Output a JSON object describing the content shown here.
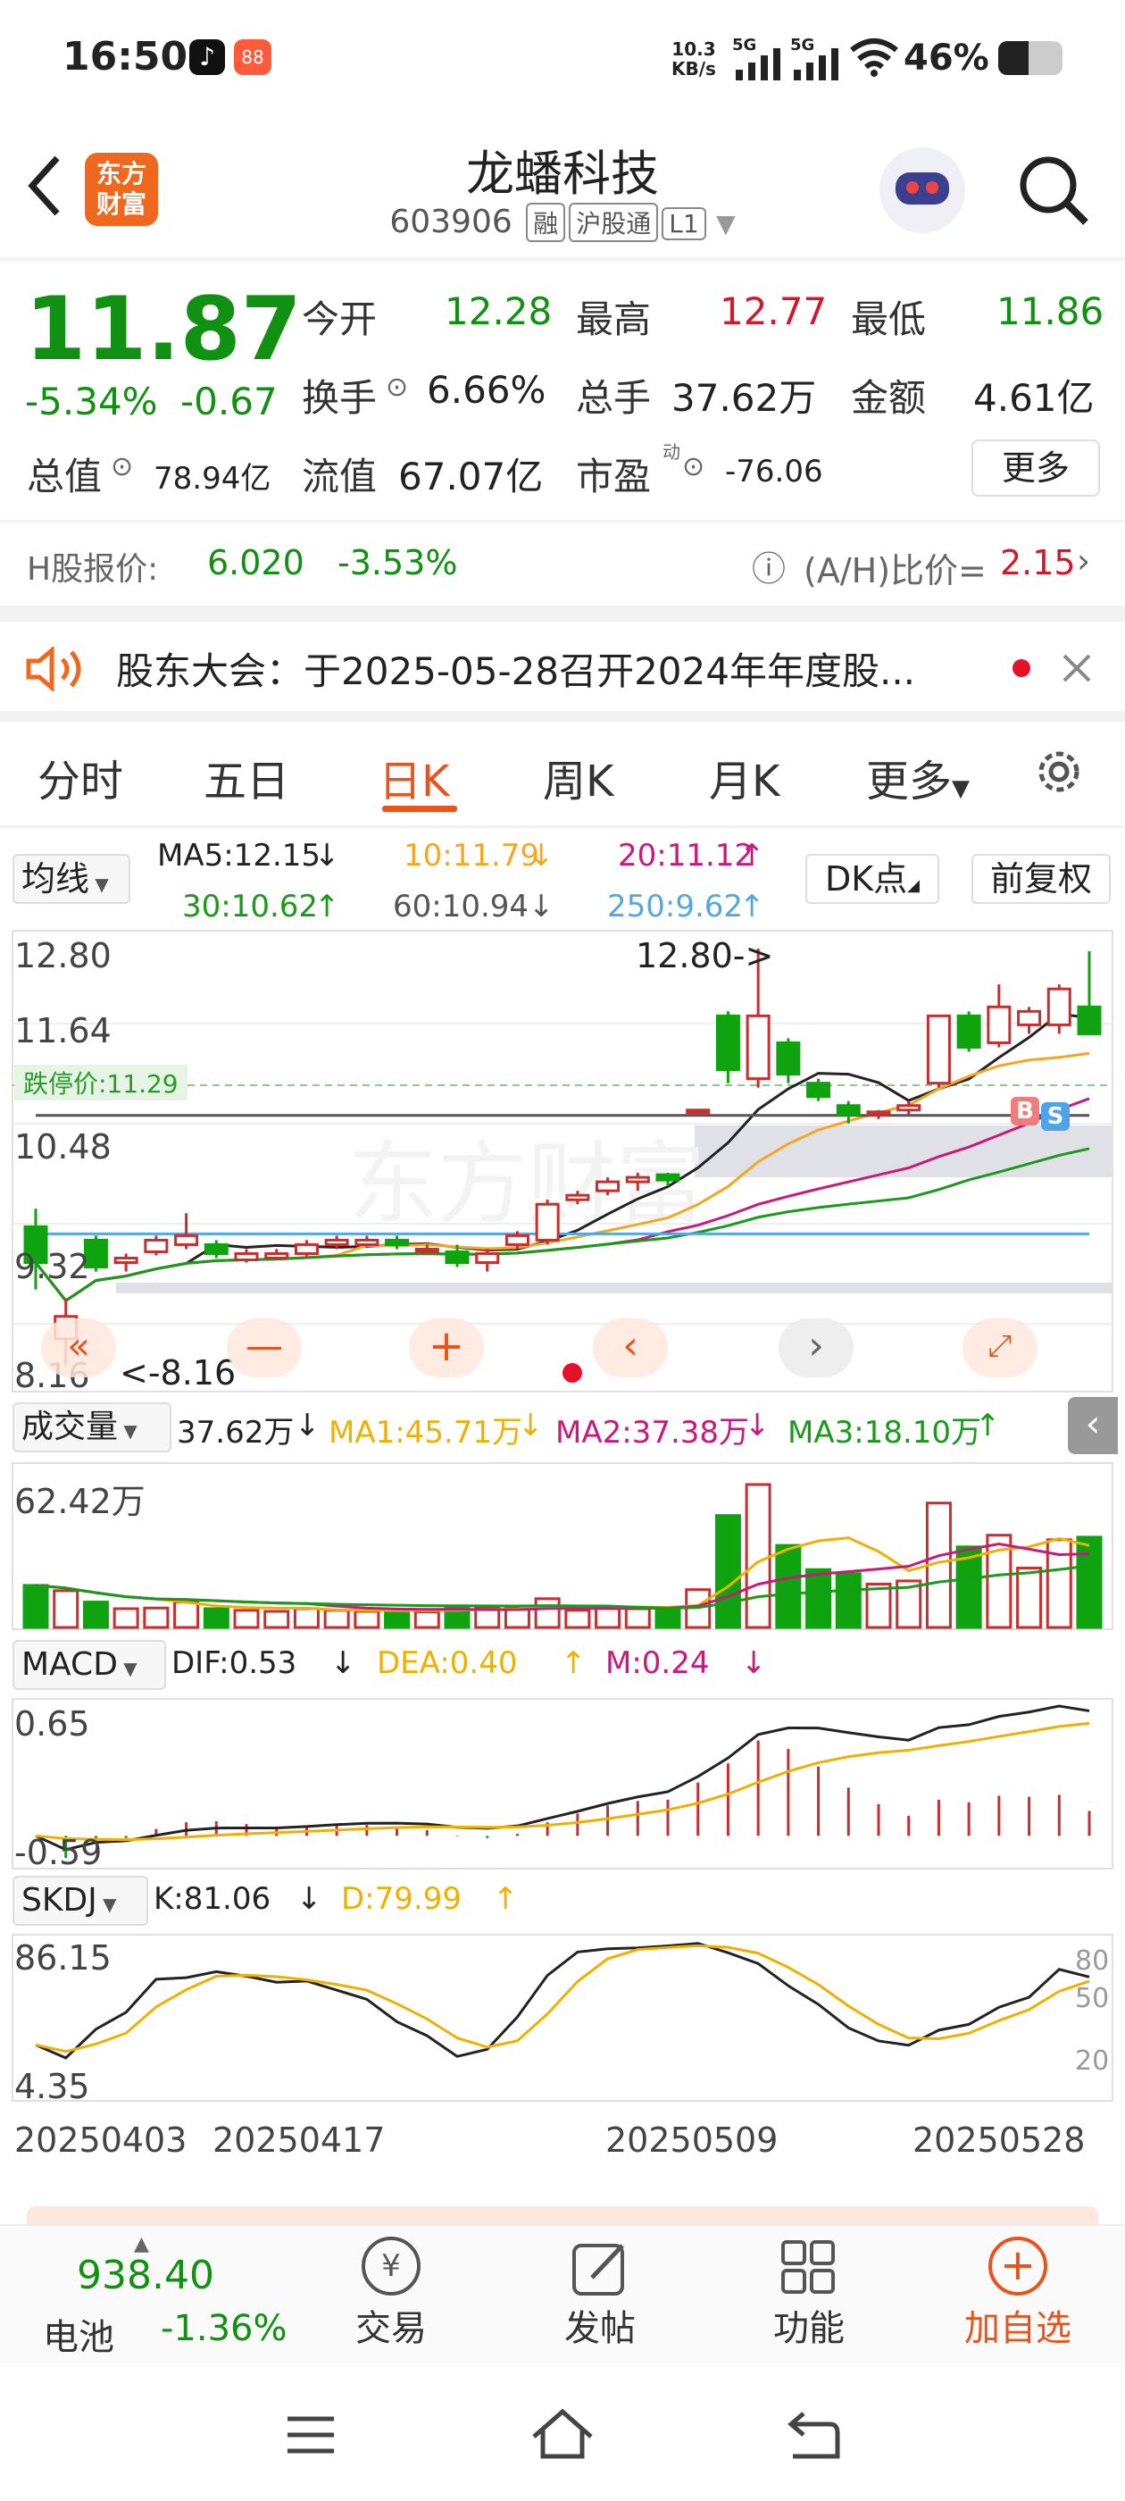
{
  "status": {
    "time": "16:50",
    "net_speed_top": "10.3",
    "net_speed_bot": "KB/s",
    "sig1": "5G",
    "sig2": "5G",
    "battery": "46%"
  },
  "header": {
    "name": "龙蟠科技",
    "code": "603906",
    "tags": [
      "融",
      "沪股通",
      "L1"
    ],
    "logo_top": "东方",
    "logo_bot": "财富"
  },
  "quote": {
    "price": "11.87",
    "pct": "-5.34%",
    "chg": "-0.67",
    "open_label": "今开",
    "open": "12.28",
    "high_label": "最高",
    "high": "12.77",
    "low_label": "最低",
    "low": "11.86",
    "turnover_label": "换手",
    "turnover": "6.66%",
    "volume_label": "总手",
    "volume": "37.62万",
    "amount_label": "金额",
    "amount": "4.61亿",
    "mktcap_label": "总值",
    "mktcap": "78.94亿",
    "float_label": "流值",
    "float": "67.07亿",
    "pe_label": "市盈",
    "pe_sup": "动",
    "pe": "-76.06",
    "more": "更多",
    "h_label": "H股报价:",
    "h_price": "6.020",
    "h_pct": "-3.53%",
    "ah_label": "(A/H)比价=",
    "ah_value": "2.15"
  },
  "notice": {
    "text": "股东大会：于2025-05-28召开2024年年度股..."
  },
  "tabs": [
    "分时",
    "五日",
    "日K",
    "周K",
    "月K",
    "更多"
  ],
  "active_tab": "日K",
  "ma": {
    "sel": "均线",
    "ma5": "MA5:12.15",
    "ma10": "10:11.79",
    "ma20": "20:11.12",
    "ma30": "30:10.62",
    "ma60": "60:10.94",
    "ma250": "250:9.62",
    "dk": "DK点",
    "fq": "前复权",
    "c5": "#222222",
    "c10": "#f5a623",
    "c20": "#c8197d",
    "c30": "#1a9a1a",
    "c60": "#555555",
    "c250": "#53a8e2"
  },
  "kline": {
    "y_labels": [
      "12.80",
      "11.64",
      "10.48",
      "9.32",
      "8.16"
    ],
    "high_mark": "12.80->",
    "low_mark": "<-8.16",
    "limit_label": "跌停价:11.29",
    "b_mark": "B",
    "s_mark": "S"
  },
  "volume": {
    "sel": "成交量",
    "cur": "37.62万",
    "ma1": "MA1:45.71万",
    "ma2": "MA2:37.38万",
    "ma3": "MA3:18.10万",
    "y_top": "62.42万"
  },
  "macd": {
    "sel": "MACD",
    "dif": "DIF:0.53",
    "dea": "DEA:0.40",
    "m": "M:0.24",
    "y_top": "0.65",
    "y_bot": "-0.59"
  },
  "skdj": {
    "sel": "SKDJ",
    "k": "K:81.06",
    "d": "D:79.99",
    "y_top": "86.15",
    "y_bot": "4.35",
    "lv80": "80",
    "lv50": "50",
    "lv20": "20"
  },
  "dates": [
    "20250403",
    "20250417",
    "20250509",
    "20250528"
  ],
  "bottom": {
    "index_val": "938.40",
    "index_name": "电池",
    "index_pct": "-1.36%",
    "trade": "交易",
    "post": "发帖",
    "func": "功能",
    "add": "加自选"
  },
  "chart_data": {
    "type": "candlestick",
    "y_range": [
      8.16,
      12.8
    ],
    "candles": [
      {
        "o": 9.7,
        "c": 9.3,
        "h": 9.9,
        "l": 9.0,
        "dir": "down"
      },
      {
        "o": 8.7,
        "c": 8.45,
        "h": 8.9,
        "l": 8.16,
        "dir": "up"
      },
      {
        "o": 9.25,
        "c": 9.55,
        "h": 9.6,
        "l": 9.2,
        "dir": "down"
      },
      {
        "o": 9.35,
        "c": 9.3,
        "h": 9.4,
        "l": 9.2,
        "dir": "up"
      },
      {
        "o": 9.42,
        "c": 9.55,
        "h": 9.6,
        "l": 9.38,
        "dir": "up"
      },
      {
        "o": 9.5,
        "c": 9.6,
        "h": 9.85,
        "l": 9.45,
        "dir": "up"
      },
      {
        "o": 9.4,
        "c": 9.5,
        "h": 9.55,
        "l": 9.35,
        "dir": "down"
      },
      {
        "o": 9.33,
        "c": 9.4,
        "h": 9.45,
        "l": 9.3,
        "dir": "up"
      },
      {
        "o": 9.35,
        "c": 9.4,
        "h": 9.45,
        "l": 9.33,
        "dir": "up"
      },
      {
        "o": 9.4,
        "c": 9.5,
        "h": 9.55,
        "l": 9.35,
        "dir": "up"
      },
      {
        "o": 9.5,
        "c": 9.55,
        "h": 9.6,
        "l": 9.45,
        "dir": "up"
      },
      {
        "o": 9.5,
        "c": 9.55,
        "h": 9.6,
        "l": 9.48,
        "dir": "up"
      },
      {
        "o": 9.55,
        "c": 9.5,
        "h": 9.6,
        "l": 9.45,
        "dir": "down"
      },
      {
        "o": 9.45,
        "c": 9.45,
        "h": 9.5,
        "l": 9.4,
        "dir": "up"
      },
      {
        "o": 9.42,
        "c": 9.3,
        "h": 9.5,
        "l": 9.25,
        "dir": "down"
      },
      {
        "o": 9.3,
        "c": 9.4,
        "h": 9.45,
        "l": 9.2,
        "dir": "up"
      },
      {
        "o": 9.5,
        "c": 9.6,
        "h": 9.65,
        "l": 9.45,
        "dir": "up"
      },
      {
        "o": 9.55,
        "c": 9.95,
        "h": 10.0,
        "l": 9.5,
        "dir": "up"
      },
      {
        "o": 10.0,
        "c": 10.05,
        "h": 10.1,
        "l": 9.95,
        "dir": "up"
      },
      {
        "o": 10.1,
        "c": 10.2,
        "h": 10.25,
        "l": 10.05,
        "dir": "up"
      },
      {
        "o": 10.2,
        "c": 10.25,
        "h": 10.3,
        "l": 10.1,
        "dir": "up"
      },
      {
        "o": 10.22,
        "c": 10.28,
        "h": 10.3,
        "l": 10.15,
        "dir": "down"
      },
      {
        "o": 11.0,
        "c": 11.0,
        "h": 11.0,
        "l": 11.0,
        "dir": "up"
      },
      {
        "o": 12.05,
        "c": 11.45,
        "h": 12.1,
        "l": 11.3,
        "dir": "down"
      },
      {
        "o": 11.35,
        "c": 12.05,
        "h": 12.8,
        "l": 11.25,
        "dir": "up"
      },
      {
        "o": 11.75,
        "c": 11.4,
        "h": 11.8,
        "l": 11.3,
        "dir": "down"
      },
      {
        "o": 11.3,
        "c": 11.15,
        "h": 11.35,
        "l": 11.1,
        "dir": "down"
      },
      {
        "o": 11.05,
        "c": 10.95,
        "h": 11.1,
        "l": 10.85,
        "dir": "down"
      },
      {
        "o": 10.95,
        "c": 10.98,
        "h": 11.0,
        "l": 10.9,
        "dir": "up"
      },
      {
        "o": 11.0,
        "c": 11.05,
        "h": 11.1,
        "l": 10.95,
        "dir": "up"
      },
      {
        "o": 11.3,
        "c": 12.05,
        "h": 12.05,
        "l": 11.25,
        "dir": "up"
      },
      {
        "o": 12.05,
        "c": 11.7,
        "h": 12.1,
        "l": 11.65,
        "dir": "down"
      },
      {
        "o": 11.75,
        "c": 12.15,
        "h": 12.4,
        "l": 11.7,
        "dir": "up"
      },
      {
        "o": 11.95,
        "c": 12.1,
        "h": 12.15,
        "l": 11.85,
        "dir": "up"
      },
      {
        "o": 11.95,
        "c": 12.35,
        "h": 12.4,
        "l": 11.85,
        "dir": "up"
      },
      {
        "o": 12.15,
        "c": 11.85,
        "h": 12.77,
        "l": 11.86,
        "dir": "down"
      }
    ]
  }
}
